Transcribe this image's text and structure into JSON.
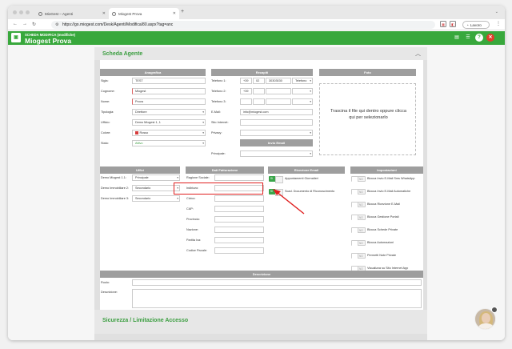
{
  "browser": {
    "tabs": [
      {
        "label": "MioGest – Agenti"
      },
      {
        "label": "Miogest Prova"
      }
    ],
    "url": "https://go.miogest.com/Desk/Agenti/Modifica/80.aspx?tag=anc",
    "profile_label": "Lavoro"
  },
  "app": {
    "subtitle": "SCHEDA MODIFICA (modifiche)",
    "title": "Miogest Prova"
  },
  "card": {
    "title": "Scheda Agente",
    "bottom_title": "Sicurezza / Limitazione Accesso"
  },
  "anagrafica": {
    "header": "Anagrafica",
    "fields": [
      {
        "label": "Sigla:",
        "value": "TEST"
      },
      {
        "label": "Cognome:",
        "value": "Miogest"
      },
      {
        "label": "Nome:",
        "value": "Prova"
      },
      {
        "label": "Tipologia:",
        "value": "Direttore"
      },
      {
        "label": "Ufficio:",
        "value": "Demo Miogest 1, 1"
      },
      {
        "label": "Colore:",
        "value": "Rosso"
      },
      {
        "label": "Stato:",
        "value": "Attivo"
      }
    ]
  },
  "recapiti": {
    "header": "Recapiti",
    "phones": [
      {
        "label": "Telefono 1:",
        "prefix": "+39",
        "area": "02",
        "number": "30303030",
        "type": "Telefono"
      },
      {
        "label": "Telefono 2:",
        "prefix": "+39",
        "area": "",
        "number": "",
        "type": ""
      },
      {
        "label": "Telefono 3:",
        "prefix": "",
        "area": "",
        "number": "",
        "type": ""
      }
    ],
    "email_label": "E-Mail:",
    "email_value": "info@miogest.com",
    "site_label": "Sito Internet:",
    "privacy_label": "Privacy:",
    "invio_header": "Invio Email",
    "principale_label": "Principale:"
  },
  "foto": {
    "header": "Foto",
    "drop_text": "Trascina il file qui dentro oppure clicca qui per selezionarlo"
  },
  "uffici": {
    "header": "Uffici",
    "rows": [
      {
        "label": "Demo Miogest 1.1:",
        "value": "Principale"
      },
      {
        "label": "Demo Immobiliare 2:",
        "value": "Secondario"
      },
      {
        "label": "Demo Immobiliare 3:",
        "value": "Secondario"
      }
    ]
  },
  "fatturazione": {
    "header": "Dati Fatturazione",
    "labels": [
      "Ragione Sociale:",
      "Indirizzo:",
      "Civico:",
      "CAP:",
      "Provincia:",
      "Nazione:",
      "Partita Iva:",
      "Codice Fiscale:"
    ]
  },
  "ricezione": {
    "header": "Ricezione Email",
    "items": [
      {
        "state": "Sì",
        "label": "Appuntamenti Giornalieri"
      },
      {
        "state": "Sì",
        "label": "Scad. Documento di Riconoscimento"
      }
    ]
  },
  "impostazioni": {
    "header": "Impostazioni",
    "items": [
      {
        "state": "NO",
        "label": "Blocca Invio E-Mail Sms WhatsApp"
      },
      {
        "state": "NO",
        "label": "Blocca Invio E-Mail Automatiche"
      },
      {
        "state": "NO",
        "label": "Blocca Ricezione E-Mail"
      },
      {
        "state": "NO",
        "label": "Blocca Gestione Portali"
      },
      {
        "state": "NO",
        "label": "Blocca Schede Private"
      },
      {
        "state": "NO",
        "label": "Blocca Automazioni"
      },
      {
        "state": "NO",
        "label": "Permetti Note Private"
      },
      {
        "state": "NO",
        "label": "Visualizza su Sito Internet App"
      },
      {
        "state": "NO",
        "label": "Visualizza su Portali"
      }
    ]
  },
  "descrizione": {
    "header": "Descrizione",
    "ruolo_label": "Ruolo:",
    "desc_label": "Descrizione:"
  },
  "colors": {
    "accent_green": "#38a83c",
    "highlight_red": "#e02020"
  }
}
